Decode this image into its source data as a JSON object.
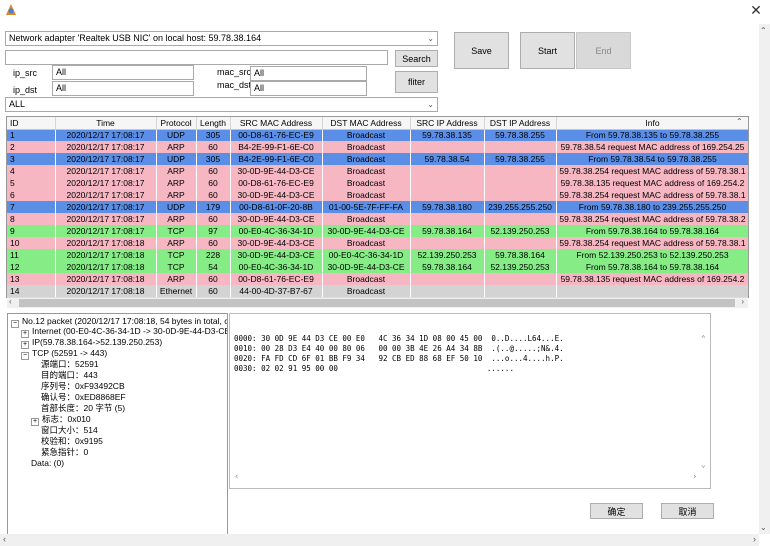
{
  "window": {
    "close_glyph": "✕"
  },
  "adapter": {
    "selected": "Network adapter 'Realtek USB NIC' on local host: 59.78.38.164"
  },
  "search": {
    "value": "",
    "button": "Search"
  },
  "filters": {
    "ip_src_label": "ip_src",
    "ip_src_value": "All",
    "ip_dst_label": "ip_dst",
    "ip_dst_value": "All",
    "mac_src_label": "mac_src",
    "mac_src_value": "All",
    "mac_dst_label": "mac_dst",
    "mac_dst_value": "All",
    "filter_button": "fliter",
    "protocol_selected": "ALL"
  },
  "controls": {
    "save": "Save",
    "start": "Start",
    "end": "End"
  },
  "table": {
    "columns": [
      "ID",
      "Time",
      "Protocol",
      "Length",
      "SRC MAC Address",
      "DST MAC Address",
      "SRC IP Address",
      "DST IP Address",
      "Info"
    ],
    "rows": [
      {
        "c": [
          "1",
          "2020/12/17 17:08:17",
          "UDP",
          "305",
          "00-D8-61-76-EC-E9",
          "Broadcast",
          "59.78.38.135",
          "59.78.38.255",
          "From 59.78.38.135 to 59.78.38.255"
        ],
        "color": "#5b8ee6"
      },
      {
        "c": [
          "2",
          "2020/12/17 17:08:17",
          "ARP",
          "60",
          "B4-2E-99-F1-6E-C0",
          "Broadcast",
          "",
          "",
          "59.78.38.54 request MAC address of 169.254.25"
        ],
        "color": "#f6b6c2"
      },
      {
        "c": [
          "3",
          "2020/12/17 17:08:17",
          "UDP",
          "305",
          "B4-2E-99-F1-6E-C0",
          "Broadcast",
          "59.78.38.54",
          "59.78.38.255",
          "From 59.78.38.54 to 59.78.38.255"
        ],
        "color": "#5b8ee6"
      },
      {
        "c": [
          "4",
          "2020/12/17 17:08:17",
          "ARP",
          "60",
          "30-0D-9E-44-D3-CE",
          "Broadcast",
          "",
          "",
          "59.78.38.254 request MAC address of 59.78.38.1"
        ],
        "color": "#f6b6c2"
      },
      {
        "c": [
          "5",
          "2020/12/17 17:08:17",
          "ARP",
          "60",
          "00-D8-61-76-EC-E9",
          "Broadcast",
          "",
          "",
          "59.78.38.135 request MAC address of 169.254.2"
        ],
        "color": "#f6b6c2"
      },
      {
        "c": [
          "6",
          "2020/12/17 17:08:17",
          "ARP",
          "60",
          "30-0D-9E-44-D3-CE",
          "Broadcast",
          "",
          "",
          "59.78.38.254 request MAC address of 59.78.38.1"
        ],
        "color": "#f6b6c2"
      },
      {
        "c": [
          "7",
          "2020/12/17 17:08:17",
          "UDP",
          "179",
          "00-D8-61-0F-20-8B",
          "01-00-5E-7F-FF-FA",
          "59.78.38.180",
          "239.255.255.250",
          "From 59.78.38.180 to 239.255.255.250"
        ],
        "color": "#5b8ee6"
      },
      {
        "c": [
          "8",
          "2020/12/17 17:08:17",
          "ARP",
          "60",
          "30-0D-9E-44-D3-CE",
          "Broadcast",
          "",
          "",
          "59.78.38.254 request MAC address of 59.78.38.2"
        ],
        "color": "#f6b6c2"
      },
      {
        "c": [
          "9",
          "2020/12/17 17:08:17",
          "TCP",
          "97",
          "00-E0-4C-36-34-1D",
          "30-0D-9E-44-D3-CE",
          "59.78.38.164",
          "52.139.250.253",
          "From 59.78.38.164 to 59.78.38.164"
        ],
        "color": "#86ec86"
      },
      {
        "c": [
          "10",
          "2020/12/17 17:08:18",
          "ARP",
          "60",
          "30-0D-9E-44-D3-CE",
          "Broadcast",
          "",
          "",
          "59.78.38.254 request MAC address of 59.78.38.1"
        ],
        "color": "#f6b6c2"
      },
      {
        "c": [
          "11",
          "2020/12/17 17:08:18",
          "TCP",
          "228",
          "30-0D-9E-44-D3-CE",
          "00-E0-4C-36-34-1D",
          "52.139.250.253",
          "59.78.38.164",
          "From 52.139.250.253 to 52.139.250.253"
        ],
        "color": "#86ec86"
      },
      {
        "c": [
          "12",
          "2020/12/17 17:08:18",
          "TCP",
          "54",
          "00-E0-4C-36-34-1D",
          "30-0D-9E-44-D3-CE",
          "59.78.38.164",
          "52.139.250.253",
          "From 59.78.38.164 to 59.78.38.164"
        ],
        "color": "#86ec86"
      },
      {
        "c": [
          "13",
          "2020/12/17 17:08:18",
          "ARP",
          "60",
          "00-D8-61-76-EC-E9",
          "Broadcast",
          "",
          "",
          "59.78.38.135 request MAC address of 169.254.2"
        ],
        "color": "#f6b6c2"
      },
      {
        "c": [
          "14",
          "2020/12/17 17:08:18",
          "Ethernet",
          "60",
          "44-00-4D-37-B7-67",
          "Broadcast",
          "",
          "",
          ""
        ],
        "color": "#d3d3d3"
      }
    ]
  },
  "tree": {
    "root": "No.12 packet (2020/12/17 17:08:18, 54 bytes in total, cap",
    "internet": "Internet (00-E0-4C-36-34-1D -> 30-0D-9E-44-D3-CE)",
    "ip": "IP(59.78.38.164->52.139.250.253)",
    "tcp": "TCP (52591 -> 443)",
    "src_port": "源端口：52591",
    "dst_port": "目的端口：443",
    "seq": "序列号：0xF93492CB",
    "ack": "确认号：0xED8868EF",
    "hdr_len": "首部长度：20 字节 (5)",
    "flags": "标志：0x010",
    "window": "窗口大小：514",
    "checksum": "校验和：0x9195",
    "urgent": "紧急指针：0",
    "data": "Data: (0)"
  },
  "hex": {
    "lines": [
      "0000: 30 0D 9E 44 D3 CE 00 E0   4C 36 34 1D 08 00 45 00  0..D....L64...E.",
      "0010: 00 28 D3 E4 40 00 80 06   00 00 3B 4E 26 A4 34 8B  .(..@.....;N&.4.",
      "0020: FA FD CD 6F 01 BB F9 34   92 CB ED 88 68 EF 50 10  ...o...4....h.P.",
      "0030: 02 02 91 95 00 00                                 ......"
    ]
  },
  "footer": {
    "ok": "确定",
    "cancel": "取消"
  }
}
